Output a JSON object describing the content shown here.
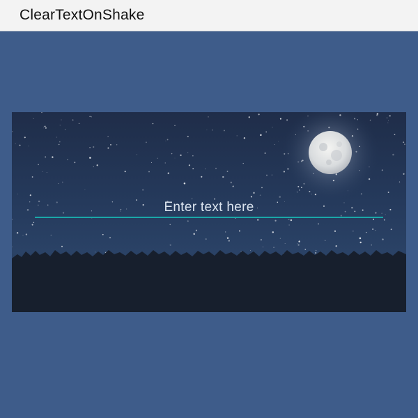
{
  "app_bar": {
    "title": "ClearTextOnShake"
  },
  "main": {
    "background_image": "night-sky-moon-treeline",
    "text_input": {
      "placeholder": "Enter text here",
      "value": ""
    }
  },
  "colors": {
    "app_bar_background": "#f3f3f3",
    "page_background": "#3e5c8a",
    "input_underline": "#1aa7a7"
  }
}
